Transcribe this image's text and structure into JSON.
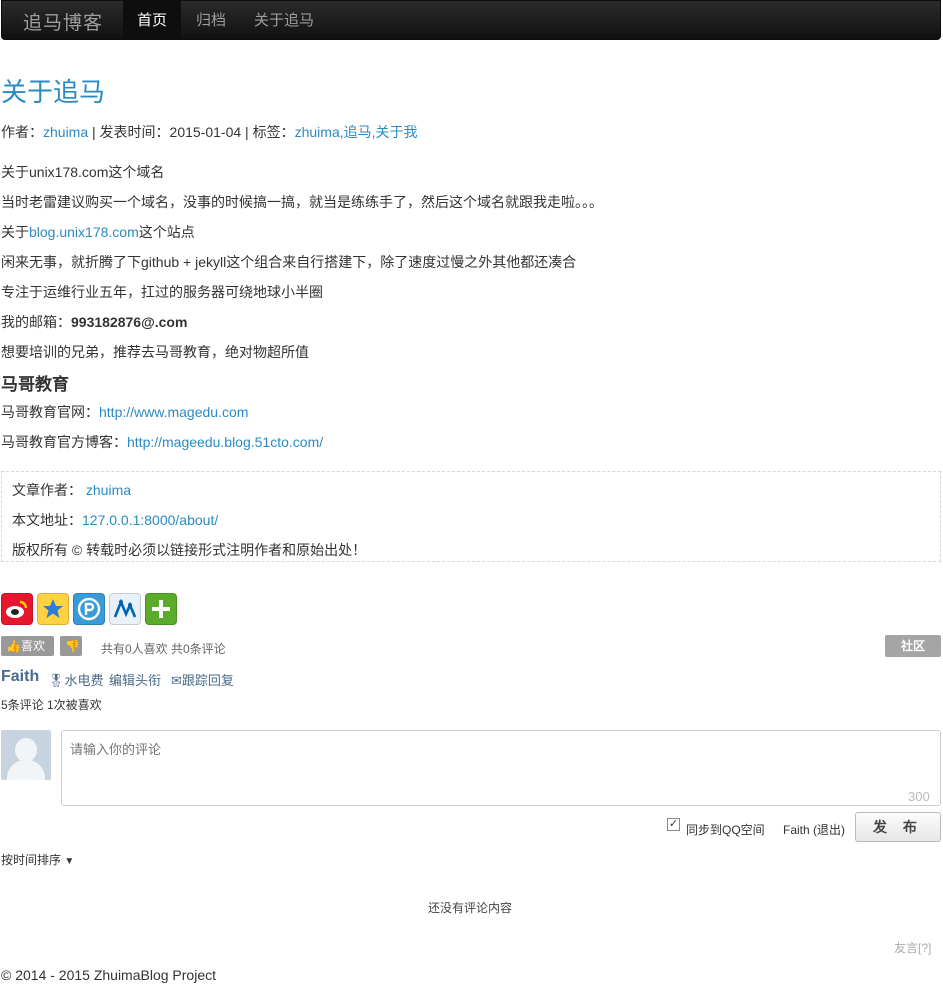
{
  "nav": {
    "brand": "追马博客",
    "items": [
      "首页",
      "归档",
      "关于追马"
    ]
  },
  "post": {
    "title": "关于追马",
    "meta": {
      "author_label": "作者：",
      "author": "zhuima",
      "date_text": " | 发表时间：2015-01-04 | 标签：",
      "tags": "zhuima,追马,关于我"
    },
    "lines": [
      "关于unix178.com这个域名",
      "当时老雷建议购买一个域名，没事的时候搞一搞，就当是练练手了，然后这个域名就跟我走啦。。。",
      "这个站点",
      "闲来无事，就折腾了下github + jekyll这个组合来自行搭建下，除了速度过慢之外其他都还凑合",
      "专注于运维行业五年，扛过的服务器可绕地球小半圈",
      "我的邮箱：",
      "想要培训的兄弟，推荐去马哥教育，绝对物超所值"
    ],
    "about_prefix": "关于",
    "site_link": "blog.unix178.com",
    "email": "993182876@.com",
    "heading": "马哥教育",
    "official_site_label": "马哥教育官网：",
    "official_site_url": "http://www.magedu.com",
    "official_blog_label": "马哥教育官方博客：",
    "official_blog_url": "http://mageedu.blog.51cto.com/"
  },
  "copyright_box": {
    "author_label": "文章作者：",
    "author": "zhuima",
    "url_label": "本文地址：",
    "url": "127.0.0.1:8000/about/",
    "notice": "版权所有 © 转载时必须以链接形式注明作者和原始出处！"
  },
  "social": {
    "like_label": "喜欢",
    "stats": "共有0人喜欢  共0条评论",
    "community_label": "社区",
    "user_name": "Faith",
    "user_links": [
      "水电费",
      "编辑头衔",
      "跟踪回复"
    ],
    "user_stats": "5条评论   1次被喜欢",
    "comment_placeholder": "请输入你的评论",
    "char_limit": "300",
    "sync_label": "同步到QQ空间",
    "login_status": "Faith (退出)",
    "publish_label": "发 布",
    "sort_label": "按时间排序",
    "empty_text": "还没有评论内容",
    "footer_link": "友言[?]"
  },
  "footer": "© 2014 - 2015 ZhuimaBlog Project",
  "colors": {
    "link": "#2a8bc2",
    "navbar": "#1b1b1b",
    "weibo": "#e6162d",
    "qzone": "#f5b700",
    "pengyou": "#2a8bc2",
    "renren": "#0063b1",
    "more": "#5aac2a"
  }
}
